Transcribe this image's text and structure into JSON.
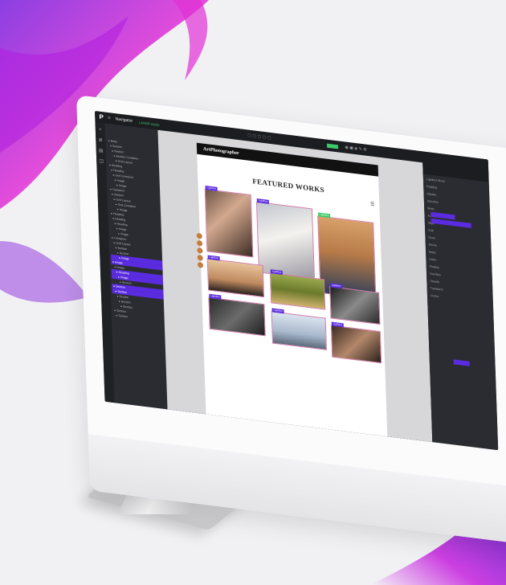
{
  "app": {
    "nav_label": "Navigator",
    "brand": "LANDR studio",
    "tree": [
      "Body",
      "Section",
      "Section",
      "Section Container",
      "Grid Layout",
      "Heading",
      "Heading",
      "Grid Container",
      "Image",
      "Image",
      "Container",
      "Section",
      "Grid Layout",
      "Grid Container",
      "Image",
      "Heading",
      "Heading",
      "Heading",
      "Image",
      "Image",
      "Container",
      "Grid Layout",
      "Section",
      "Section",
      "Image",
      "Image",
      "Image",
      "Heading",
      "Image",
      "Section",
      "Section",
      "Section",
      "Section",
      "Section",
      "Section",
      "Section",
      "Section"
    ],
    "selected_rows": [
      24,
      25,
      27,
      28,
      30,
      31
    ]
  },
  "site": {
    "logo": "ArtPhotographer",
    "heading": "FEATURED WORKS",
    "tag": "Lightbox"
  },
  "right": {
    "lines": [
      "Lightbox Show",
      "Padding",
      "Display",
      "Direction",
      "Wrap",
      "Justify",
      "Align",
      "Gap",
      "Grow",
      "Shrink",
      "Basis",
      "Order",
      "Position",
      "Overflow",
      "Opacity",
      "Transform",
      "Cursor"
    ]
  },
  "colors": {
    "accent": "#5a2be0",
    "frame": "#d07aa8",
    "green": "#3ec96b"
  }
}
